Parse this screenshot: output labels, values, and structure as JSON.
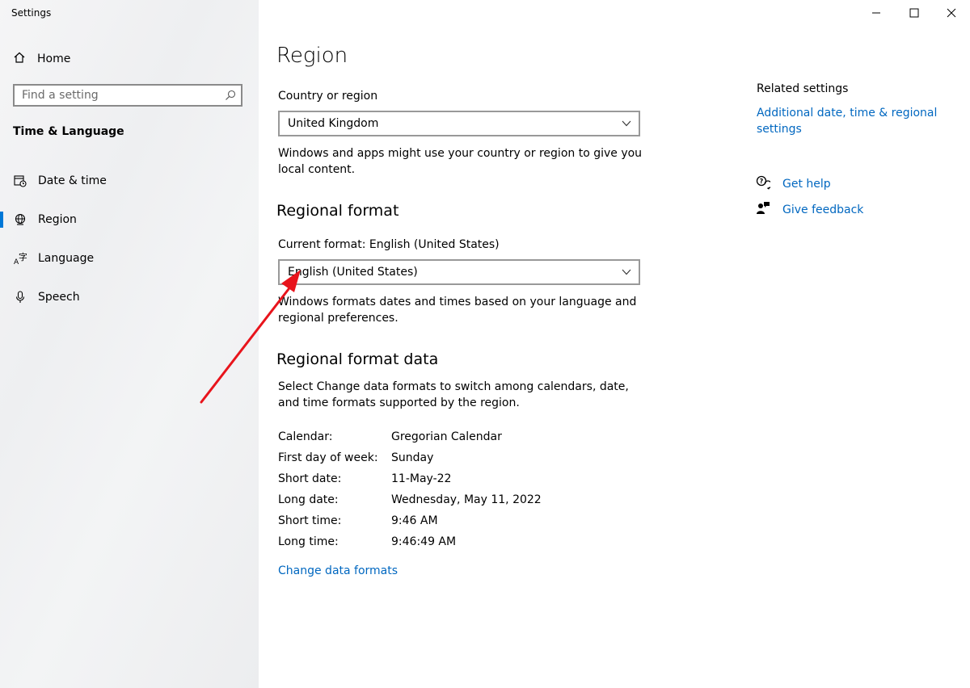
{
  "app": {
    "title": "Settings"
  },
  "sidebar": {
    "home_label": "Home",
    "search_placeholder": "Find a setting",
    "section_title": "Time & Language",
    "items": [
      {
        "label": "Date & time",
        "icon": "calendar-clock-icon",
        "active": false
      },
      {
        "label": "Region",
        "icon": "globe-icon",
        "active": true
      },
      {
        "label": "Language",
        "icon": "language-icon",
        "active": false
      },
      {
        "label": "Speech",
        "icon": "microphone-icon",
        "active": false
      }
    ]
  },
  "main": {
    "title": "Region",
    "country_label": "Country or region",
    "country_value": "United Kingdom",
    "country_desc": "Windows and apps might use your country or region to give you local content.",
    "regional_format_heading": "Regional format",
    "current_format_label": "Current format: English (United States)",
    "format_value": "English (United States)",
    "format_desc": "Windows formats dates and times based on your language and regional preferences.",
    "format_data_heading": "Regional format data",
    "format_data_desc": "Select Change data formats to switch among calendars, date, and time formats supported by the region.",
    "format_rows": [
      {
        "key": "Calendar:",
        "value": "Gregorian Calendar"
      },
      {
        "key": "First day of week:",
        "value": "Sunday"
      },
      {
        "key": "Short date:",
        "value": "11-May-22"
      },
      {
        "key": "Long date:",
        "value": "Wednesday, May 11, 2022"
      },
      {
        "key": "Short time:",
        "value": "9:46 AM"
      },
      {
        "key": "Long time:",
        "value": "9:46:49 AM"
      }
    ],
    "change_link": "Change data formats"
  },
  "related": {
    "title": "Related settings",
    "link": "Additional date, time & regional settings",
    "get_help": "Get help",
    "give_feedback": "Give feedback"
  },
  "colors": {
    "accent": "#0078d7",
    "link": "#0067c0",
    "annotation_arrow": "#e8141c"
  }
}
